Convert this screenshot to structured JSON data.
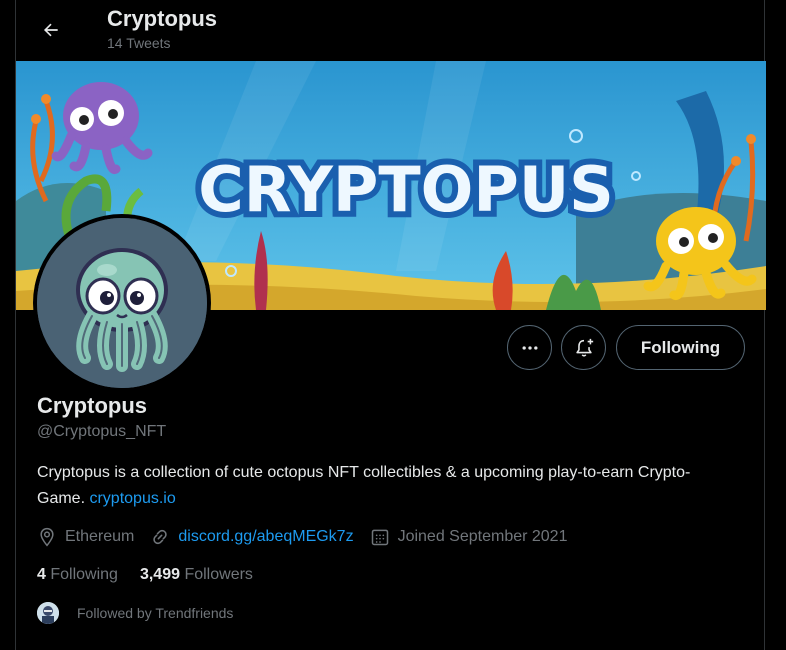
{
  "header": {
    "title": "Cryptopus",
    "tweet_count": "14 Tweets",
    "back_icon": "arrow-left-icon"
  },
  "banner": {
    "wordmark": "CRYPTOPUS",
    "colors": {
      "sky": "#2f9fd8",
      "sand": "#e8c441",
      "text": "#ffffff",
      "text_outline": "#1a5fae"
    }
  },
  "profile": {
    "name": "Cryptopus",
    "handle": "@Cryptopus_NFT",
    "bio": "Cryptopus is a collection of cute octopus NFT collectibles & a upcoming play-to-earn Crypto-Game.",
    "bio_link": "cryptopus.io",
    "location": "Ethereum",
    "website": "discord.gg/abeqMEGk7z",
    "joined": "Joined September 2021"
  },
  "actions": {
    "more_icon": "more-horizontal-icon",
    "notify_icon": "bell-plus-icon",
    "follow_label": "Following"
  },
  "stats": {
    "following_count": "4",
    "following_label": "Following",
    "followers_count": "3,499",
    "followers_label": "Followers"
  },
  "followed_by": {
    "text": "Followed by Trendfriends"
  },
  "colors": {
    "background": "#000000",
    "text_primary": "#e7e9ea",
    "text_secondary": "#71767b",
    "link": "#1d9bf0",
    "border": "#2f3336"
  }
}
